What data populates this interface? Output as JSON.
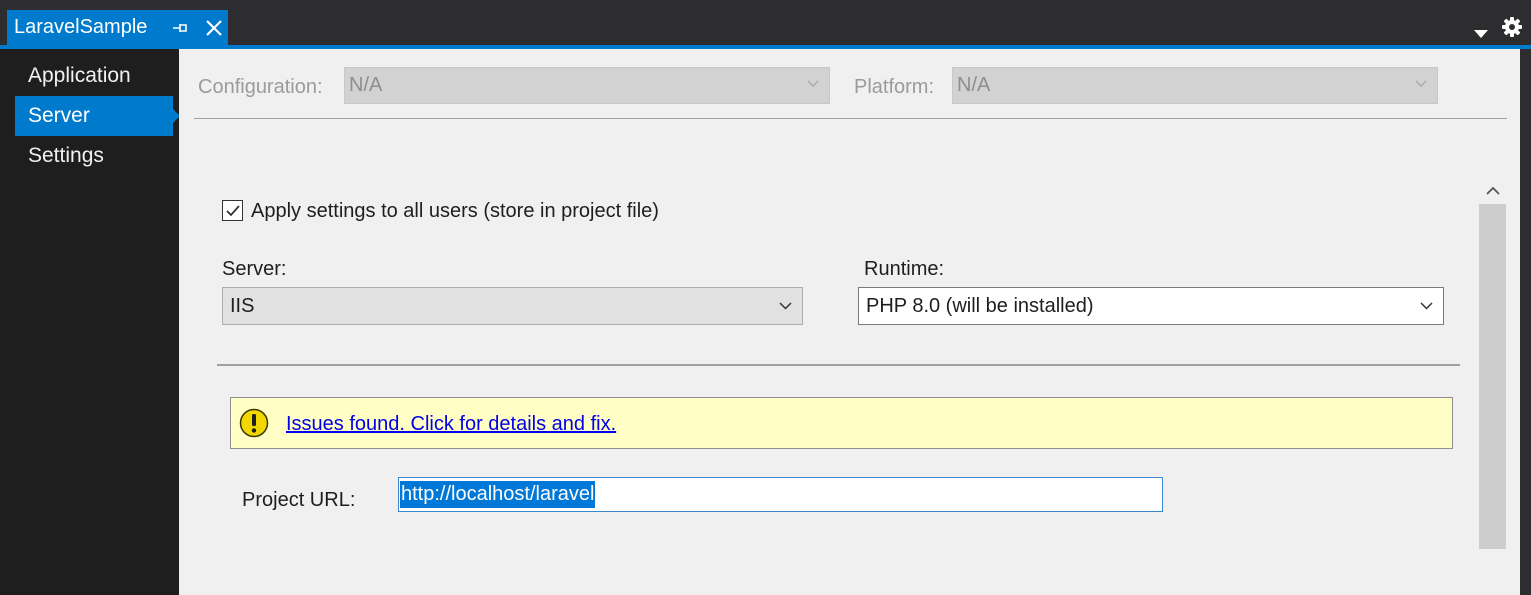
{
  "tab": {
    "title": "LaravelSample"
  },
  "nav": {
    "items": [
      "Application",
      "Server",
      "Settings"
    ]
  },
  "config": {
    "configuration_label": "Configuration:",
    "configuration_value": "N/A",
    "platform_label": "Platform:",
    "platform_value": "N/A"
  },
  "server_page": {
    "apply_all_users_label": "Apply settings to all users (store in project file)",
    "apply_all_users_checked": true,
    "server_label": "Server:",
    "server_value": "IIS",
    "runtime_label": "Runtime:",
    "runtime_value": "PHP 8.0 (will be installed)",
    "issues_link": "Issues found. Click for details and fix.",
    "project_url_label": "Project URL:",
    "project_url_value": "http://localhost/laravel"
  },
  "colors": {
    "accent": "#007acc",
    "warning_background": "#ffffc5",
    "link": "#0000ee"
  }
}
